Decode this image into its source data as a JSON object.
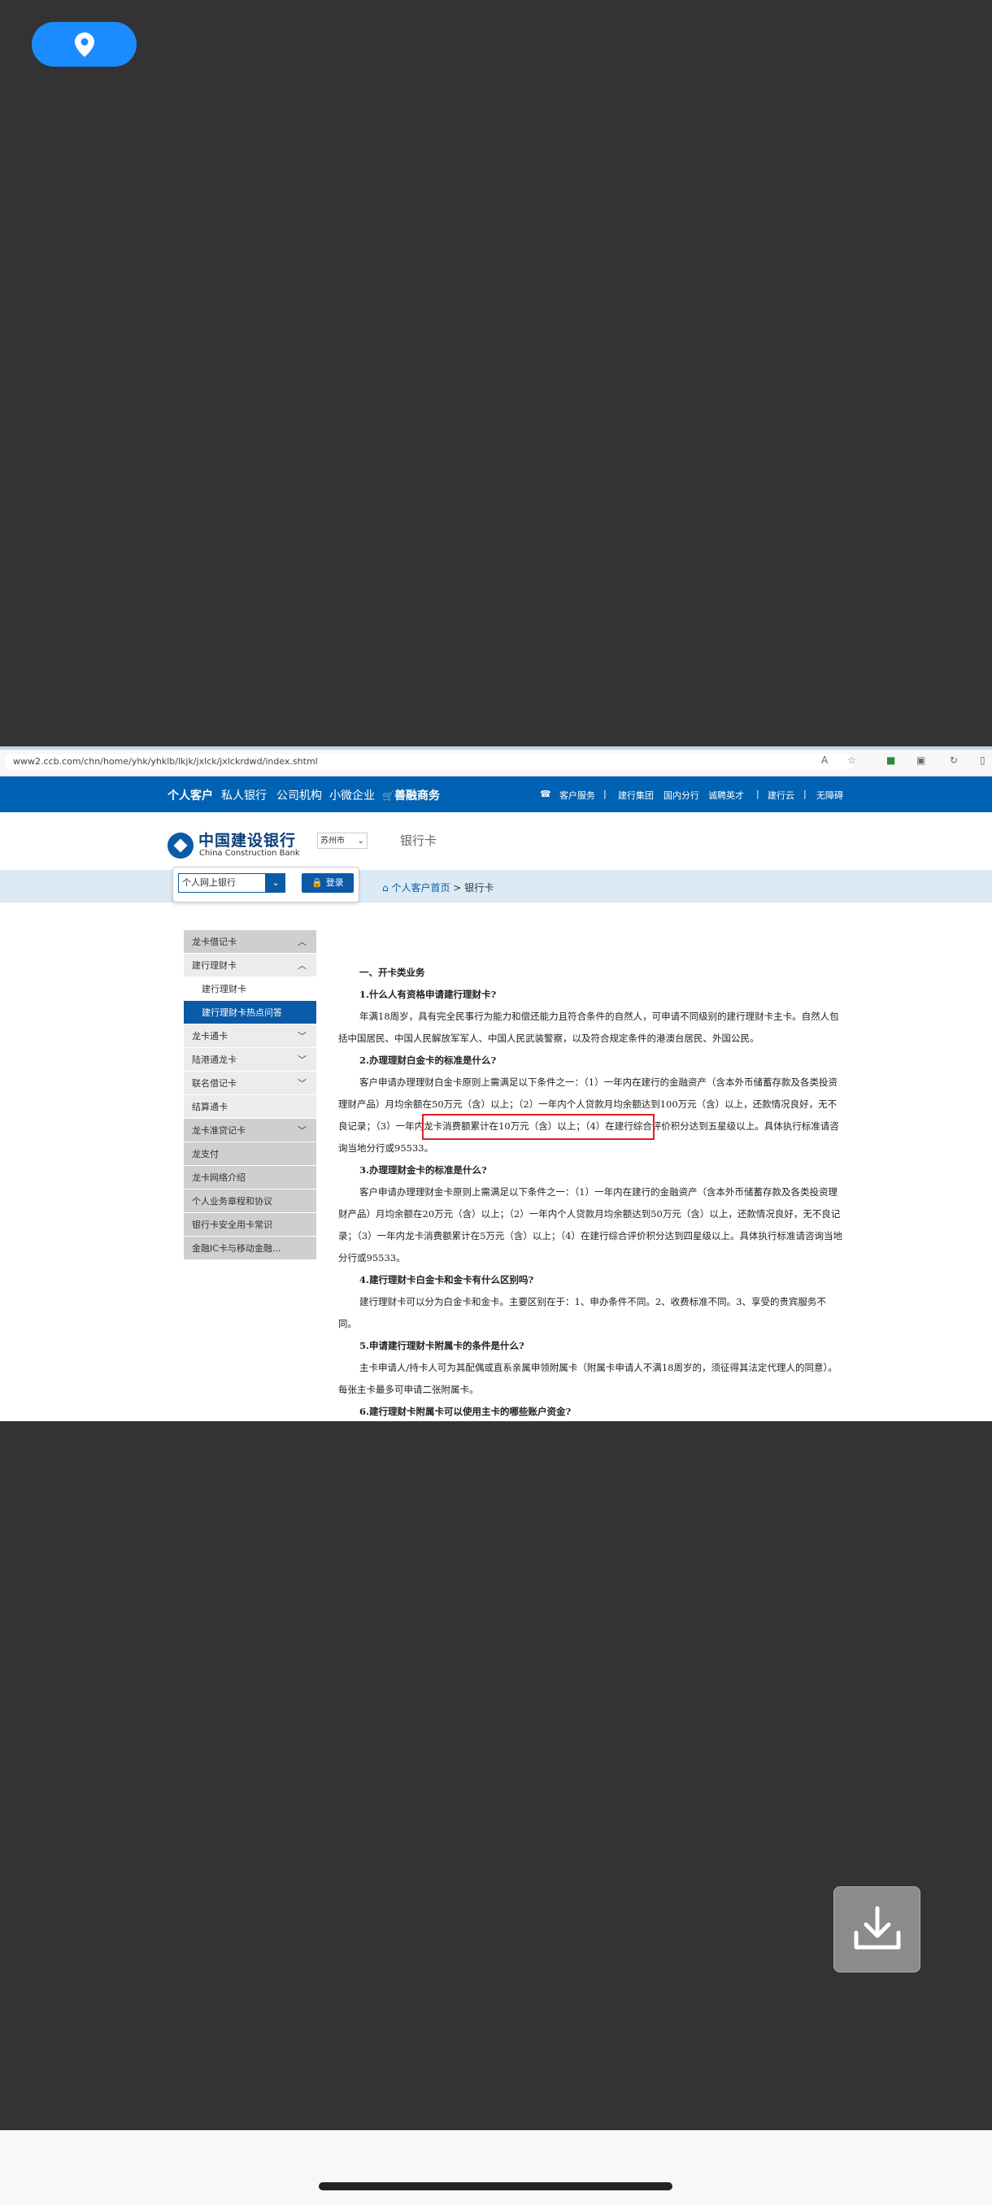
{
  "browser": {
    "url": "www2.ccb.com/chn/home/yhk/yhklb/lkjk/jxlck/jxlckrdwd/index.shtml",
    "icons": [
      "read-aloud-icon",
      "favorite-star-icon",
      "extension-icon",
      "collections-icon",
      "refresh-icon",
      "sidebar-icon"
    ]
  },
  "topnav": {
    "items": [
      "个人客户",
      "私人银行",
      "公司机构",
      "小微企业",
      "善融商务"
    ],
    "right_items": [
      "客户服务",
      "建行集团",
      "国内分行",
      "诚聘英才",
      "建行云",
      "无障碍"
    ]
  },
  "brand": {
    "name_cn": "中国建设银行",
    "name_en": "China Construction Bank",
    "city": "苏州市",
    "section": "银行卡"
  },
  "login": {
    "select_value": "个人网上银行",
    "button": "登录"
  },
  "breadcrumb": {
    "home": "个人客户首页",
    "sep": ">",
    "current": "银行卡"
  },
  "sidebar": {
    "items": [
      "龙卡借记卡",
      "建行理财卡",
      "建行理财卡",
      "建行理财卡热点问答",
      "龙卡通卡",
      "陆港通龙卡",
      "联名借记卡",
      "结算通卡",
      "龙卡准贷记卡",
      "龙支付",
      "龙卡网络介绍",
      "个人业务章程和协议",
      "银行卡安全用卡常识",
      "金融IC卡与移动金融..."
    ]
  },
  "content": {
    "section_title": "一、开卡类业务",
    "q1": "1.什么人有资格申请建行理财卡?",
    "a1": "年满18周岁，具有完全民事行为能力和偿还能力且符合条件的自然人，可申请不同级别的建行理财卡主卡。自然人包括中国居民、中国人民解放军军人、中国人民武装警察，以及符合规定条件的港澳台居民、外国公民。",
    "q2": "2.办理理财白金卡的标准是什么?",
    "a2": "客户申请办理理财白金卡原则上需满足以下条件之一：（1）一年内在建行的金融资产（含本外币储蓄存款及各类投资理财产品）月均余额在50万元（含）以上；（2）一年内个人贷款月均余额达到100万元（含）以上，还款情况良好，无不良记录；（3）一年内龙卡消费额累计在10万元（含）以上；（4）在建行综合评价积分达到五星级以上。具体执行标准请咨询当地分行或95533。",
    "q3": "3.办理理财金卡的标准是什么?",
    "a3": "客户申请办理理财金卡原则上需满足以下条件之一：（1）一年内在建行的金融资产（含本外币储蓄存款及各类投资理财产品）月均余额在20万元（含）以上；（2）一年内个人贷款月均余额达到50万元（含）以上，还款情况良好，无不良记录；（3）一年内龙卡消费额累计在5万元（含）以上；（4）在建行综合评价积分达到四星级以上。具体执行标准请咨询当地分行或95533。",
    "q4": "4.建行理财卡白金卡和金卡有什么区别吗?",
    "a4": "建行理财卡可以分为白金卡和金卡。主要区别在于：1、申办条件不同。2、收费标准不同。3、享受的贵宾服务不同。",
    "q5": "5.申请建行理财卡附属卡的条件是什么?",
    "a5": "主卡申请人/持卡人可为其配偶或直系亲属申领附属卡（附属卡申请人不满18周岁的，须征得其法定代理人的同意）。每张主卡最多可申请二张附属卡。",
    "q6": "6.建行理财卡附属卡可以使用主卡的哪些账户资金?"
  },
  "colors": {
    "brand_blue": "#0062b2",
    "dark_bg": "#333333",
    "highlight_red": "#e02020",
    "location_button": "#1a8cff"
  }
}
